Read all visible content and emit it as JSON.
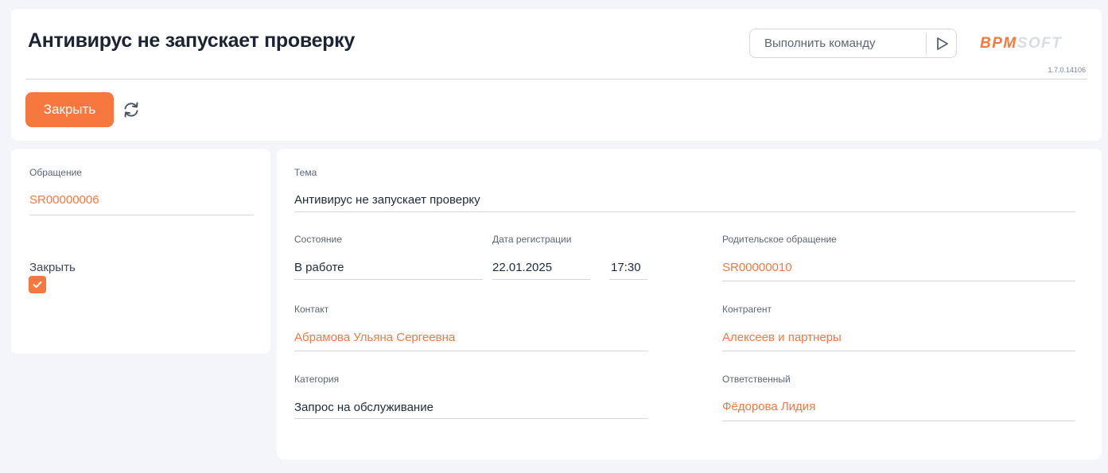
{
  "header": {
    "title": "Антивирус не запускает проверку",
    "command_placeholder": "Выполнить команду",
    "logo_text": "BPMSOFT",
    "version": "1.7.0.14106",
    "close_label": "Закрыть"
  },
  "left_panel": {
    "request_label": "Обращение",
    "request_value": "SR00000006",
    "close_label": "Закрыть",
    "close_checked": true
  },
  "details": {
    "subject_label": "Тема",
    "subject_value": "Антивирус не запускает проверку",
    "status_label": "Состояние",
    "status_value": "В работе",
    "reg_date_label": "Дата регистрации",
    "reg_date_value": "22.01.2025",
    "reg_time_value": "17:30",
    "parent_label": "Родительское обращение",
    "parent_value": "SR00000010",
    "contact_label": "Контакт",
    "contact_value": "Абрамова Ульяна Сергеевна",
    "account_label": "Контрагент",
    "account_value": "Алексеев и партнеры",
    "category_label": "Категория",
    "category_value": "Запрос на обслуживание",
    "owner_label": "Ответственный",
    "owner_value": "Фёдорова Лидия"
  },
  "colors": {
    "accent": "#f6783f",
    "background": "#f4f5f9",
    "card": "#ffffff",
    "text": "#1f2a37",
    "label": "#5b6573"
  },
  "icons": {
    "run": "play-icon",
    "refresh": "refresh-icon",
    "check": "check-icon"
  }
}
